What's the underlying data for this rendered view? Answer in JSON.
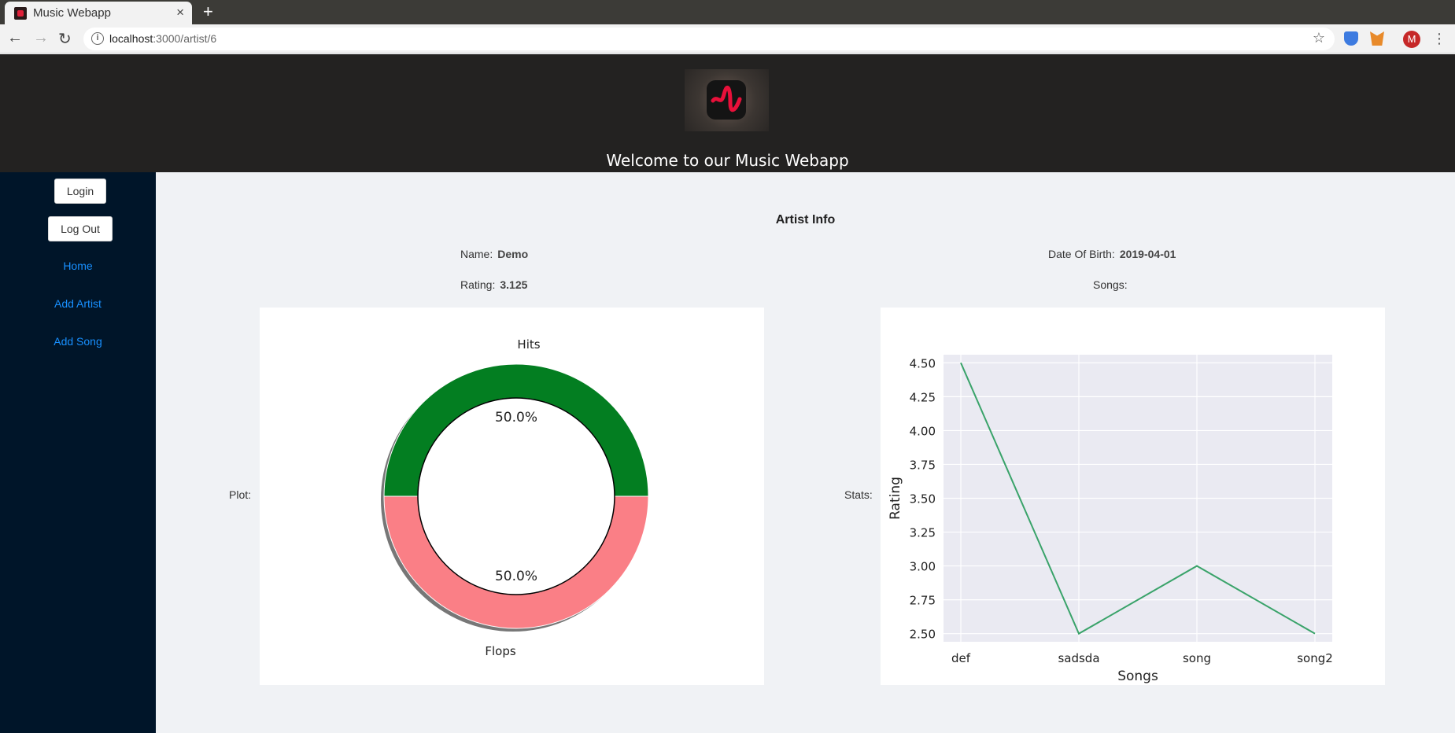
{
  "browser": {
    "tab_title": "Music Webapp",
    "tab_close": "×",
    "new_tab": "+",
    "url_host": "localhost",
    "url_path": ":3000/artist/6",
    "avatar_initial": "M"
  },
  "header": {
    "title": "Welcome to our Music Webapp"
  },
  "sidebar": {
    "login_label": "Login",
    "logout_label": "Log Out",
    "links": [
      "Home",
      "Add Artist",
      "Add Song"
    ]
  },
  "artist": {
    "section_title": "Artist Info",
    "name_label": "Name",
    "name_value": "Demo",
    "dob_label": "Date Of Birth",
    "dob_value": "2019-04-01",
    "rating_label": "Rating",
    "rating_value": "3.125",
    "songs_label": "Songs",
    "plot_label": "Plot",
    "stats_label": "Stats"
  },
  "colors": {
    "hits": "#037e21",
    "flops": "#fa7f86",
    "line": "#3aa36a",
    "plot_bg": "#eaeaf2"
  },
  "chart_data": [
    {
      "type": "pie",
      "labels": [
        "Hits",
        "Flops"
      ],
      "values": [
        50.0,
        50.0
      ],
      "value_labels": [
        "50.0%",
        "50.0%"
      ],
      "style": "donut"
    },
    {
      "type": "line",
      "categories": [
        "def",
        "sadsda",
        "song",
        "song2"
      ],
      "values": [
        4.5,
        2.5,
        3.0,
        2.5
      ],
      "xlabel": "Songs",
      "ylabel": "Rating",
      "ylim": [
        2.44,
        4.56
      ],
      "yticks": [
        "2.50",
        "2.75",
        "3.00",
        "3.25",
        "3.50",
        "3.75",
        "4.00",
        "4.25",
        "4.50"
      ],
      "grid": true
    }
  ]
}
